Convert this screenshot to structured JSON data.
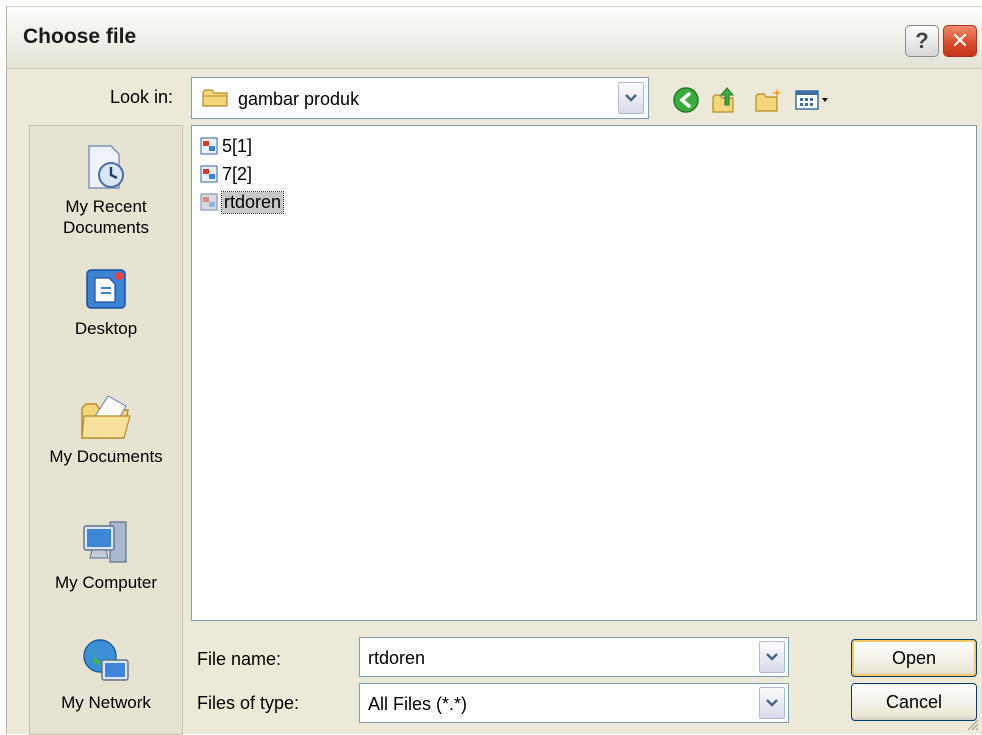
{
  "window": {
    "title": "Choose file",
    "help_label": "?",
    "close_label": "✕"
  },
  "lookin": {
    "label": "Look in:",
    "value": "gambar produk"
  },
  "places": [
    {
      "label_line1": "My Recent",
      "label_line2": "Documents"
    },
    {
      "label_line1": "Desktop"
    },
    {
      "label_line1": "My Documents"
    },
    {
      "label_line1": "My Computer"
    },
    {
      "label_line1": "My Network"
    }
  ],
  "files": [
    {
      "name": "5[1]"
    },
    {
      "name": "7[2]"
    },
    {
      "name": "rtdoren",
      "selected": true
    }
  ],
  "filename": {
    "label": "File name:",
    "value": "rtdoren"
  },
  "filetype": {
    "label": "Files of type:",
    "value": "All Files (*.*)"
  },
  "buttons": {
    "open": "Open",
    "cancel": "Cancel"
  },
  "colors": {
    "dialog_bg": "#ece9d8",
    "selection": "#c8c8c8",
    "border": "#7f9db9"
  }
}
